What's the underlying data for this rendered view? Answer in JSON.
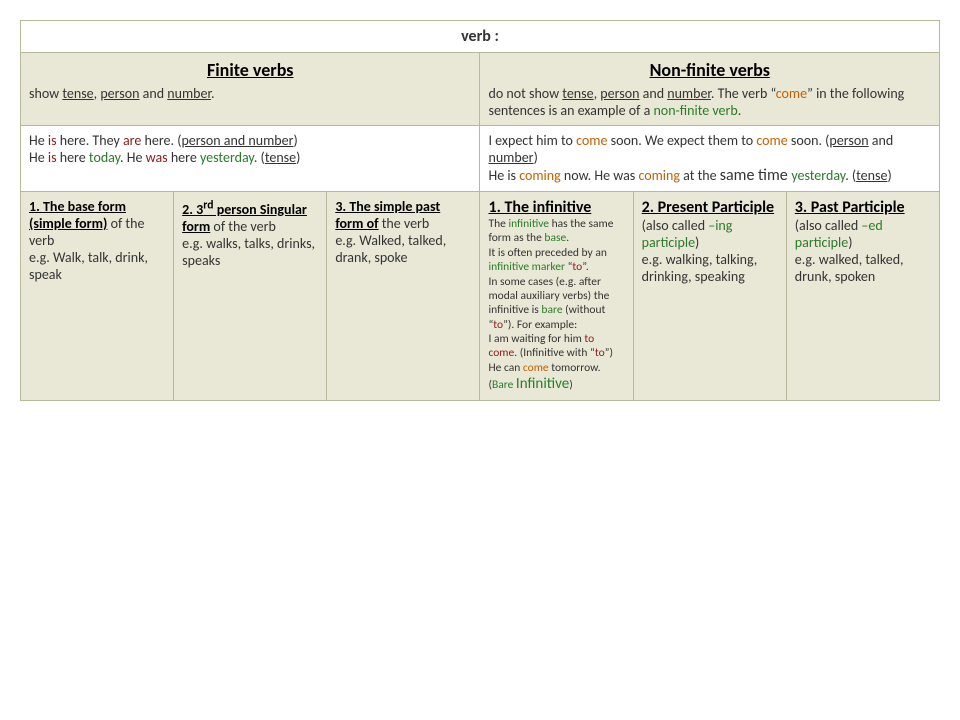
{
  "header": "verb :",
  "left": {
    "title": "Finite verbs",
    "desc_pre": "show ",
    "desc_u1": "tense",
    "desc_sep1": ", ",
    "desc_u2": "person",
    "desc_sep2": " and ",
    "desc_u3": "number",
    "desc_post": "."
  },
  "right": {
    "title": "Non-finite verbs",
    "desc_pre": "do not show ",
    "desc_u1": "tense",
    "desc_sep1": ", ",
    "desc_u2": "person",
    "desc_sep2": " and ",
    "desc_u3": "number",
    "desc_mid": ". The verb “",
    "desc_orange": "come",
    "desc_mid2": "” in the following sentences is an example of a ",
    "desc_green": "non-finite verb",
    "desc_post": "."
  },
  "ex_left": {
    "a1": "He ",
    "a2": "is",
    "a3": " here. They ",
    "a4": "are",
    "a5": " here. (",
    "a6": "person and number",
    "a7": ")",
    "b1": "He ",
    "b2": "is",
    "b3": " here ",
    "b4": "today",
    "b5": ". He ",
    "b6": "was",
    "b7": " here ",
    "b8": "yesterday",
    "b9": ". (",
    "b10": "tense",
    "b11": ")"
  },
  "ex_right": {
    "a1": "I expect him to ",
    "a2": "come",
    "a3": " soon. We expect them to ",
    "a4": "come",
    "a5": " soon. (",
    "a6": "person",
    "a7": " and ",
    "a8": "number",
    "a9": ")",
    "b1": "He is ",
    "b2": "coming",
    "b3": " now. He was ",
    "b4": "coming",
    "b5": " at the ",
    "b6": "same time ",
    "b7": "yesterday",
    "b8": ". (",
    "b9": "tense",
    "b10": ")"
  },
  "cells": {
    "c1": {
      "h": "1. The base form (simple form)",
      "t": " of the verb",
      "eg": "e.g. Walk, talk, drink, speak"
    },
    "c2": {
      "h": "2. 3",
      "sup": "rd",
      "h2": " person Singular form",
      "t": " of the verb",
      "eg": "e.g. walks, talks, drinks, speaks"
    },
    "c3": {
      "h": "3. The simple past form of",
      "t": " the verb",
      "eg": "e.g. Walked, talked, drank, spoke"
    },
    "c4": {
      "h": "1. The infinitive",
      "l1a": "The ",
      "l1g": "infinitive",
      "l1b": " has the same form as the ",
      "l1g2": "base",
      "l1c": ".",
      "l2a": "It is often preceded by an ",
      "l2g": "infinitive marker",
      "l2b": " “",
      "l2m": "to",
      "l2c": "”.",
      "l3": "In some cases (e.g. after modal auxiliary verbs) the infinitive is ",
      "l3g": "bare",
      "l3b": " (without “",
      "l3m": "to",
      "l3c": "”). For example:",
      "l4a": "I am waiting for him ",
      "l4m": "to come",
      "l4b": ". (Infinitive with “",
      "l4m2": "to",
      "l4c": "”)",
      "l5a": "He can ",
      "l5o": "come",
      "l5b": " tomorrow. (",
      "l5g": "Bare ",
      "l5big": "Infinitive",
      "l5c": ")"
    },
    "c5": {
      "h": "2. Present Participle",
      "t1": "(also called ",
      "g": "–ing participle",
      "t2": ")",
      "eg": "e.g. walking, talking, drinking, speaking"
    },
    "c6": {
      "h": "3. Past Participle",
      "t1": "(also called ",
      "g": "–ed participle",
      "t2": ")",
      "eg": "e.g. walked, talked, drunk, spoken"
    }
  }
}
